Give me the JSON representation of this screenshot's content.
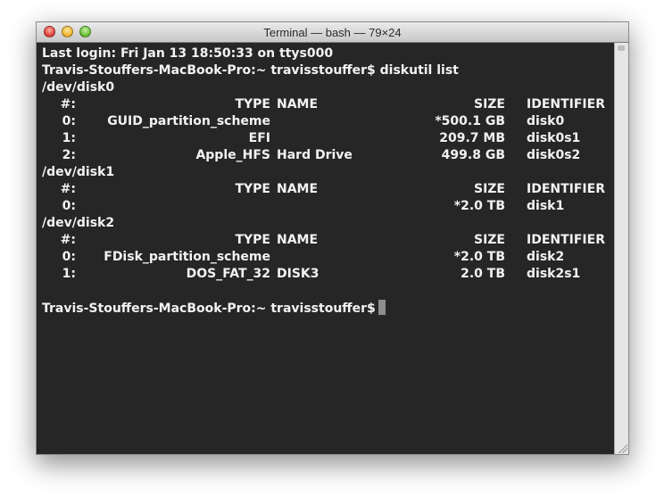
{
  "window": {
    "title": "Terminal — bash — 79×24"
  },
  "terminal": {
    "last_login": "Last login: Fri Jan 13 18:50:33 on ttys000",
    "prompt_command": "Travis-Stouffers-MacBook-Pro:~ travisstouffer$ diskutil list",
    "prompt_final": "Travis-Stouffers-MacBook-Pro:~ travisstouffer$",
    "disks": [
      {
        "device": "/dev/disk0",
        "header": {
          "num": "#:",
          "type": "TYPE",
          "name": "NAME",
          "size": "SIZE",
          "identifier": "IDENTIFIER"
        },
        "rows": [
          {
            "num": "0:",
            "type": "GUID_partition_scheme",
            "name": "",
            "size": "*500.1 GB",
            "identifier": "disk0"
          },
          {
            "num": "1:",
            "type": "EFI",
            "name": "",
            "size": "209.7 MB",
            "identifier": "disk0s1"
          },
          {
            "num": "2:",
            "type": "Apple_HFS",
            "name": "Hard Drive",
            "size": "499.8 GB",
            "identifier": "disk0s2"
          }
        ]
      },
      {
        "device": "/dev/disk1",
        "header": {
          "num": "#:",
          "type": "TYPE",
          "name": "NAME",
          "size": "SIZE",
          "identifier": "IDENTIFIER"
        },
        "rows": [
          {
            "num": "0:",
            "type": "",
            "name": "",
            "size": "*2.0 TB",
            "identifier": "disk1"
          }
        ]
      },
      {
        "device": "/dev/disk2",
        "header": {
          "num": "#:",
          "type": "TYPE",
          "name": "NAME",
          "size": "SIZE",
          "identifier": "IDENTIFIER"
        },
        "rows": [
          {
            "num": "0:",
            "type": "FDisk_partition_scheme",
            "name": "",
            "size": "*2.0 TB",
            "identifier": "disk2"
          },
          {
            "num": "1:",
            "type": "DOS_FAT_32",
            "name": "DISK3",
            "size": "2.0 TB",
            "identifier": "disk2s1"
          }
        ]
      }
    ]
  }
}
